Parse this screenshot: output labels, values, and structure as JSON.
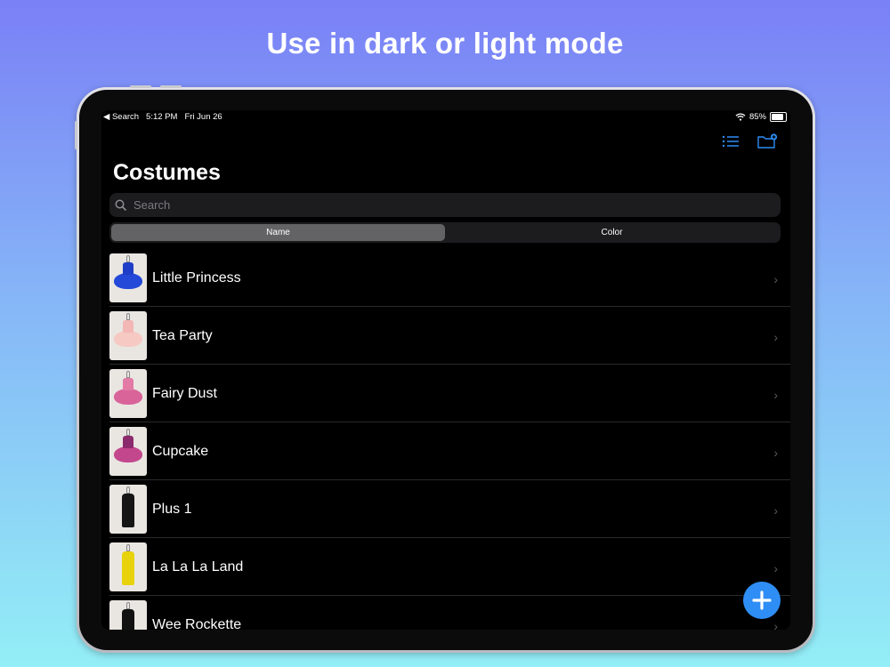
{
  "marketing": {
    "headline": "Use in dark or light mode"
  },
  "status_bar": {
    "back_label": "◀ Search",
    "time": "5:12 PM",
    "date": "Fri Jun 26",
    "battery": "85%",
    "battery_level": 0.85
  },
  "nav": {
    "icons": [
      "list-icon",
      "folder-add-icon"
    ],
    "accent_color": "#2f8ef5"
  },
  "page": {
    "title": "Costumes"
  },
  "search": {
    "placeholder": "Search",
    "value": ""
  },
  "segmented": {
    "options": [
      "Name",
      "Color"
    ],
    "selected": "Name"
  },
  "costumes": [
    {
      "name": "Little Princess",
      "thumb_colors": [
        "#1f3ec7",
        "#2448d8"
      ]
    },
    {
      "name": "Tea Party",
      "thumb_colors": [
        "#f3b7b5",
        "#f6c9c3"
      ]
    },
    {
      "name": "Fairy Dust",
      "thumb_colors": [
        "#e27aa5",
        "#d9649a"
      ]
    },
    {
      "name": "Cupcake",
      "thumb_colors": [
        "#8b2b6e",
        "#c3478d"
      ]
    },
    {
      "name": "Plus 1",
      "thumb_colors": [
        "#151515",
        "#151515"
      ]
    },
    {
      "name": "La La La Land",
      "thumb_colors": [
        "#e7d20c",
        "#e7d20c"
      ]
    },
    {
      "name": "Wee Rockette",
      "thumb_colors": [
        "#111111",
        "#111111"
      ]
    }
  ],
  "fab": {
    "icon": "plus-icon",
    "color": "#2f8ef5"
  }
}
